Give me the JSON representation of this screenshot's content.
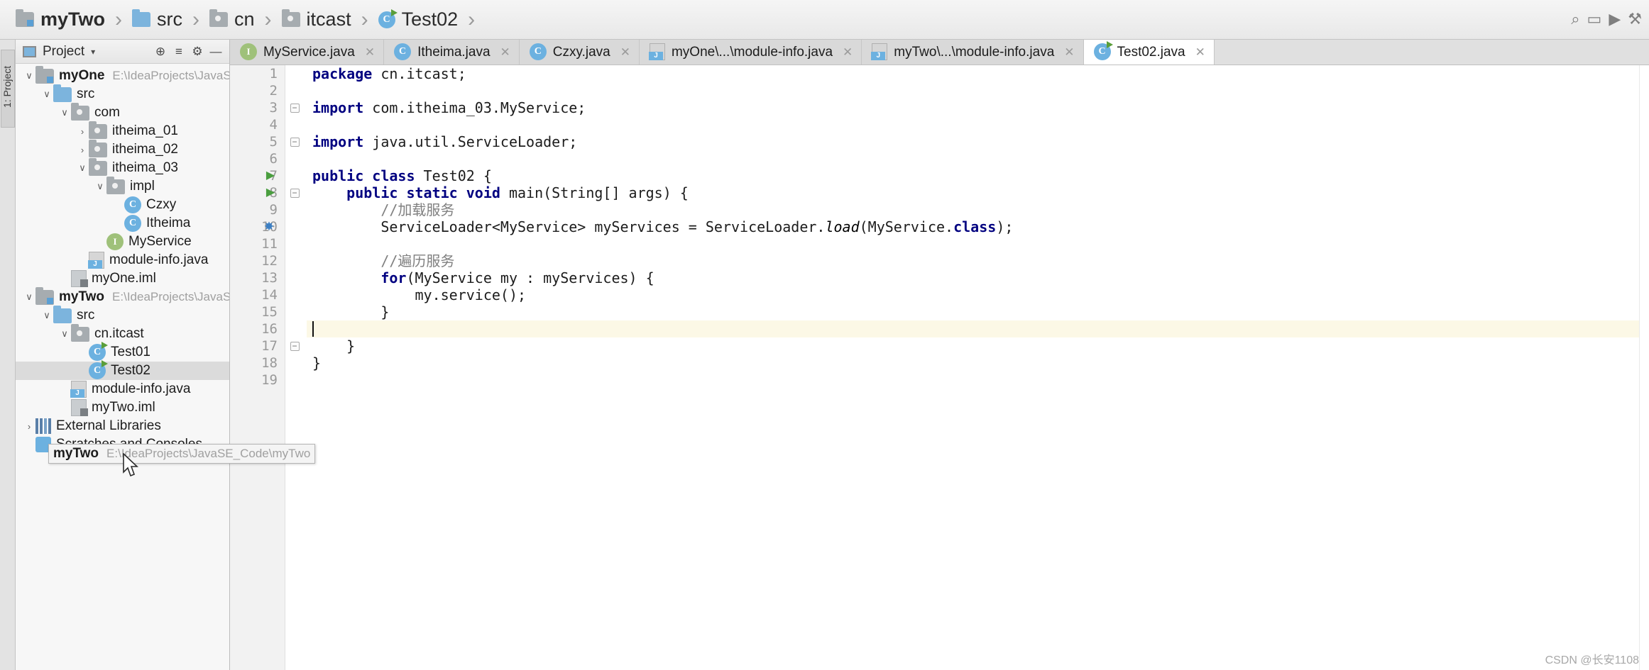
{
  "breadcrumb": {
    "items": [
      {
        "label": "myTwo",
        "icon": "module-folder-icon",
        "bold": true
      },
      {
        "label": "src",
        "icon": "source-folder-icon",
        "bold": false
      },
      {
        "label": "cn",
        "icon": "package-folder-icon",
        "bold": false
      },
      {
        "label": "itcast",
        "icon": "package-folder-icon",
        "bold": false
      },
      {
        "label": "Test02",
        "icon": "runnable-class-icon",
        "bold": false
      }
    ],
    "separator": "›"
  },
  "project_panel": {
    "title": "Project",
    "caret": "▾",
    "vertical_tab": "1: Project",
    "buttons": [
      {
        "name": "locate-button",
        "glyph": "⊕"
      },
      {
        "name": "collapse-all-button",
        "glyph": "≡"
      },
      {
        "name": "settings-button",
        "glyph": "⚙"
      },
      {
        "name": "hide-button",
        "glyph": "—"
      }
    ],
    "tree": [
      {
        "depth": 0,
        "twisty": "∨",
        "icon": "module-folder-icon",
        "label": "myOne",
        "bold": true,
        "path": "E:\\IdeaProjects\\JavaSE_Co",
        "selected": false
      },
      {
        "depth": 1,
        "twisty": "∨",
        "icon": "source-folder-icon",
        "label": "src",
        "bold": false,
        "path": "",
        "selected": false
      },
      {
        "depth": 2,
        "twisty": "∨",
        "icon": "package-folder-icon",
        "label": "com",
        "bold": false,
        "path": "",
        "selected": false
      },
      {
        "depth": 3,
        "twisty": "›",
        "icon": "package-folder-icon",
        "label": "itheima_01",
        "bold": false,
        "path": "",
        "selected": false
      },
      {
        "depth": 3,
        "twisty": "›",
        "icon": "package-folder-icon",
        "label": "itheima_02",
        "bold": false,
        "path": "",
        "selected": false
      },
      {
        "depth": 3,
        "twisty": "∨",
        "icon": "package-folder-icon",
        "label": "itheima_03",
        "bold": false,
        "path": "",
        "selected": false
      },
      {
        "depth": 4,
        "twisty": "∨",
        "icon": "package-folder-icon",
        "label": "impl",
        "bold": false,
        "path": "",
        "selected": false
      },
      {
        "depth": 5,
        "twisty": "",
        "icon": "class-icon",
        "label": "Czxy",
        "bold": false,
        "path": "",
        "selected": false
      },
      {
        "depth": 5,
        "twisty": "",
        "icon": "class-icon",
        "label": "Itheima",
        "bold": false,
        "path": "",
        "selected": false
      },
      {
        "depth": 4,
        "twisty": "",
        "icon": "interface-icon",
        "label": "MyService",
        "bold": false,
        "path": "",
        "selected": false
      },
      {
        "depth": 3,
        "twisty": "",
        "icon": "java-file-icon",
        "label": "module-info.java",
        "bold": false,
        "path": "",
        "selected": false
      },
      {
        "depth": 2,
        "twisty": "",
        "icon": "iml-file-icon",
        "label": "myOne.iml",
        "bold": false,
        "path": "",
        "selected": false
      },
      {
        "depth": 0,
        "twisty": "∨",
        "icon": "module-folder-icon",
        "label": "myTwo",
        "bold": true,
        "path": "E:\\IdeaProjects\\JavaSE_Code\\myTwo",
        "selected": false
      },
      {
        "depth": 1,
        "twisty": "∨",
        "icon": "source-folder-icon",
        "label": "src",
        "bold": false,
        "path": "",
        "selected": false
      },
      {
        "depth": 2,
        "twisty": "∨",
        "icon": "package-folder-icon",
        "label": "cn.itcast",
        "bold": false,
        "path": "",
        "selected": false
      },
      {
        "depth": 3,
        "twisty": "",
        "icon": "runnable-class-icon",
        "label": "Test01",
        "bold": false,
        "path": "",
        "selected": false
      },
      {
        "depth": 3,
        "twisty": "",
        "icon": "runnable-class-icon",
        "label": "Test02",
        "bold": false,
        "path": "",
        "selected": true
      },
      {
        "depth": 2,
        "twisty": "",
        "icon": "java-file-icon",
        "label": "module-info.java",
        "bold": false,
        "path": "",
        "selected": false
      },
      {
        "depth": 2,
        "twisty": "",
        "icon": "iml-file-icon",
        "label": "myTwo.iml",
        "bold": false,
        "path": "",
        "selected": false
      },
      {
        "depth": 0,
        "twisty": "›",
        "icon": "libraries-icon",
        "label": "External Libraries",
        "bold": false,
        "path": "",
        "selected": false
      },
      {
        "depth": 0,
        "twisty": "",
        "icon": "scratches-icon",
        "label": "Scratches and Consoles",
        "bold": false,
        "path": "",
        "selected": false
      }
    ],
    "tooltip": {
      "label": "myTwo",
      "path": "E:\\IdeaProjects\\JavaSE_Code\\myTwo"
    }
  },
  "editor": {
    "tabs": [
      {
        "label": "MyService.java",
        "icon": "interface-icon",
        "active": false,
        "close": "✕"
      },
      {
        "label": "Itheima.java",
        "icon": "class-icon",
        "active": false,
        "close": "✕"
      },
      {
        "label": "Czxy.java",
        "icon": "class-icon",
        "active": false,
        "close": "✕"
      },
      {
        "label": "myOne\\...\\module-info.java",
        "icon": "java-file-icon",
        "active": false,
        "close": "✕"
      },
      {
        "label": "myTwo\\...\\module-info.java",
        "icon": "java-file-icon",
        "active": false,
        "close": "✕"
      },
      {
        "label": "Test02.java",
        "icon": "runnable-class-icon",
        "active": true,
        "close": "✕"
      }
    ],
    "line_numbers": [
      "1",
      "2",
      "3",
      "4",
      "5",
      "6",
      "7",
      "8",
      "9",
      "10",
      "11",
      "12",
      "13",
      "14",
      "15",
      "16",
      "17",
      "18",
      "19"
    ],
    "caret_line": 16,
    "markers": [
      {
        "line": 3,
        "type": "fold",
        "glyph": "−"
      },
      {
        "line": 5,
        "type": "fold",
        "glyph": "−"
      },
      {
        "line": 7,
        "type": "run",
        "glyph": "▶"
      },
      {
        "line": 8,
        "type": "run",
        "glyph": "▶"
      },
      {
        "line": 8,
        "type": "fold",
        "glyph": "−"
      },
      {
        "line": 10,
        "type": "bean",
        "glyph": "✸"
      },
      {
        "line": 17,
        "type": "fold",
        "glyph": "−"
      }
    ],
    "code_lines": [
      [
        {
          "t": "package ",
          "c": "kw"
        },
        {
          "t": "cn.itcast;",
          "c": "plain"
        }
      ],
      [],
      [
        {
          "t": "import ",
          "c": "kw"
        },
        {
          "t": "com.itheima_03.MyService;",
          "c": "plain"
        }
      ],
      [],
      [
        {
          "t": "import ",
          "c": "kw"
        },
        {
          "t": "java.util.ServiceLoader;",
          "c": "plain"
        }
      ],
      [],
      [
        {
          "t": "public class ",
          "c": "kw"
        },
        {
          "t": "Test02 {",
          "c": "plain"
        }
      ],
      [
        {
          "t": "    public static ",
          "c": "kw"
        },
        {
          "t": "void ",
          "c": "kw"
        },
        {
          "t": "main(String[] args) {",
          "c": "plain"
        }
      ],
      [
        {
          "t": "        ",
          "c": "plain"
        },
        {
          "t": "//加载服务",
          "c": "cmt"
        }
      ],
      [
        {
          "t": "        ServiceLoader<MyService> myServices = ServiceLoader.",
          "c": "plain"
        },
        {
          "t": "load",
          "c": "ital"
        },
        {
          "t": "(MyService.",
          "c": "plain"
        },
        {
          "t": "class",
          "c": "kw"
        },
        {
          "t": ");",
          "c": "plain"
        }
      ],
      [],
      [
        {
          "t": "        ",
          "c": "plain"
        },
        {
          "t": "//遍历服务",
          "c": "cmt"
        }
      ],
      [
        {
          "t": "        ",
          "c": "plain"
        },
        {
          "t": "for",
          "c": "kw"
        },
        {
          "t": "(MyService my : myServices) {",
          "c": "plain"
        }
      ],
      [
        {
          "t": "            my.service();",
          "c": "plain"
        }
      ],
      [
        {
          "t": "        }",
          "c": "plain"
        }
      ],
      [],
      [
        {
          "t": "    }",
          "c": "plain"
        }
      ],
      [
        {
          "t": "}",
          "c": "plain"
        }
      ],
      []
    ]
  },
  "top_right_tools": [
    {
      "name": "search-everywhere-icon",
      "glyph": "⌕"
    },
    {
      "name": "run-config-icon",
      "glyph": "▭"
    },
    {
      "name": "run-icon",
      "glyph": "▶"
    },
    {
      "name": "build-icon",
      "glyph": "⚒"
    }
  ],
  "watermark": "CSDN @长安1108"
}
